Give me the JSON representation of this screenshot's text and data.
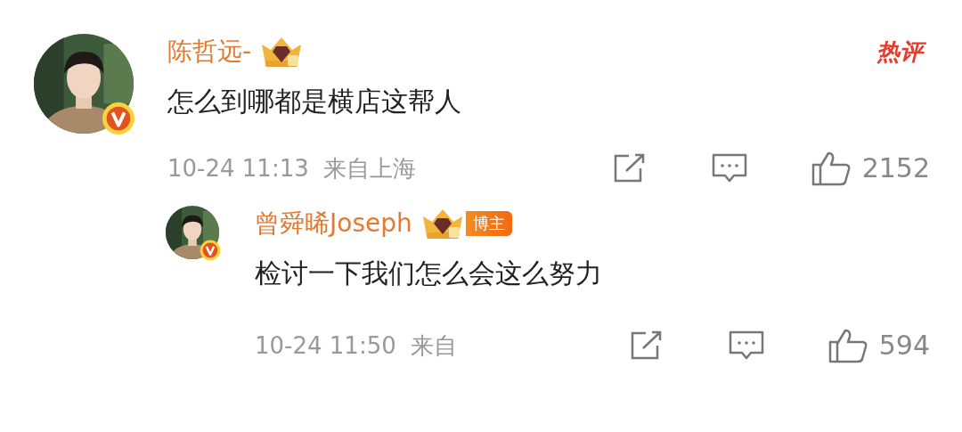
{
  "comments": [
    {
      "author": "陈哲远-",
      "verified": true,
      "tag": "热评",
      "text": "怎么到哪都是横店这帮人",
      "time": "10-24 11:13",
      "location": "来自上海",
      "likes": "2152"
    },
    {
      "author": "曾舜晞Joseph",
      "verified": true,
      "role": "博主",
      "text": "检讨一下我们怎么会这么努力",
      "time": "10-24 11:50",
      "location": "来自",
      "likes": "594"
    }
  ]
}
